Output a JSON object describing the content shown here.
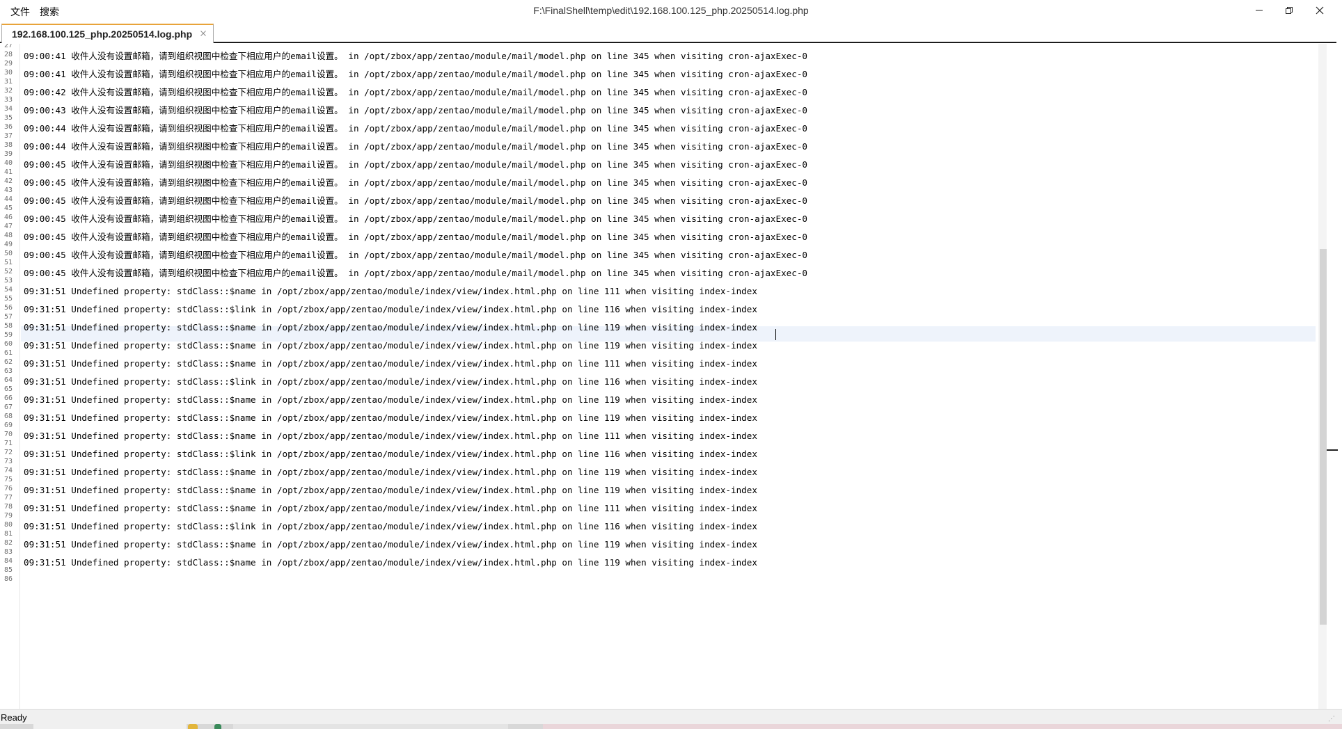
{
  "menu": {
    "file": "文件",
    "search": "搜索"
  },
  "window": {
    "title": "F:\\FinalShell\\temp\\edit\\192.168.100.125_php.20250514.log.php"
  },
  "tab": {
    "label": "192.168.100.125_php.20250514.log.php"
  },
  "status": {
    "text": "Ready"
  },
  "icons": {
    "minimize": "minimize-icon",
    "restore": "restore-icon",
    "close": "close-icon",
    "tab_close": "close-icon"
  },
  "editor": {
    "line_numbers": [
      "27",
      "28",
      "29",
      "30",
      "31",
      "32",
      "33",
      "34",
      "35",
      "36",
      "37",
      "38",
      "39",
      "40",
      "41",
      "42",
      "43",
      "44",
      "45",
      "46",
      "47",
      "48",
      "49",
      "50",
      "51",
      "52",
      "53",
      "54",
      "55",
      "56",
      "57",
      "58",
      "59",
      "60",
      "61",
      "62",
      "63",
      "64",
      "65",
      "66",
      "67",
      "68",
      "69",
      "70",
      "71",
      "72",
      "73",
      "74",
      "75",
      "76",
      "77",
      "78",
      "79",
      "80",
      "81",
      "82",
      "83",
      "84",
      "85",
      "86"
    ],
    "current_line": "53",
    "log_lines": [
      "09:00:41 收件人没有设置邮箱，请到组织视图中检查下相应用户的email设置。 in /opt/zbox/app/zentao/module/mail/model.php on line 345 when visiting cron-ajaxExec-0",
      "09:00:41 收件人没有设置邮箱，请到组织视图中检查下相应用户的email设置。 in /opt/zbox/app/zentao/module/mail/model.php on line 345 when visiting cron-ajaxExec-0",
      "09:00:41 收件人没有设置邮箱，请到组织视图中检查下相应用户的email设置。 in /opt/zbox/app/zentao/module/mail/model.php on line 345 when visiting cron-ajaxExec-0",
      "09:00:42 收件人没有设置邮箱，请到组织视图中检查下相应用户的email设置。 in /opt/zbox/app/zentao/module/mail/model.php on line 345 when visiting cron-ajaxExec-0",
      "09:00:43 收件人没有设置邮箱，请到组织视图中检查下相应用户的email设置。 in /opt/zbox/app/zentao/module/mail/model.php on line 345 when visiting cron-ajaxExec-0",
      "09:00:44 收件人没有设置邮箱，请到组织视图中检查下相应用户的email设置。 in /opt/zbox/app/zentao/module/mail/model.php on line 345 when visiting cron-ajaxExec-0",
      "09:00:44 收件人没有设置邮箱，请到组织视图中检查下相应用户的email设置。 in /opt/zbox/app/zentao/module/mail/model.php on line 345 when visiting cron-ajaxExec-0",
      "09:00:45 收件人没有设置邮箱，请到组织视图中检查下相应用户的email设置。 in /opt/zbox/app/zentao/module/mail/model.php on line 345 when visiting cron-ajaxExec-0",
      "09:00:45 收件人没有设置邮箱，请到组织视图中检查下相应用户的email设置。 in /opt/zbox/app/zentao/module/mail/model.php on line 345 when visiting cron-ajaxExec-0",
      "09:00:45 收件人没有设置邮箱，请到组织视图中检查下相应用户的email设置。 in /opt/zbox/app/zentao/module/mail/model.php on line 345 when visiting cron-ajaxExec-0",
      "09:00:45 收件人没有设置邮箱，请到组织视图中检查下相应用户的email设置。 in /opt/zbox/app/zentao/module/mail/model.php on line 345 when visiting cron-ajaxExec-0",
      "09:00:45 收件人没有设置邮箱，请到组织视图中检查下相应用户的email设置。 in /opt/zbox/app/zentao/module/mail/model.php on line 345 when visiting cron-ajaxExec-0",
      "09:00:45 收件人没有设置邮箱，请到组织视图中检查下相应用户的email设置。 in /opt/zbox/app/zentao/module/mail/model.php on line 345 when visiting cron-ajaxExec-0",
      "09:00:45 收件人没有设置邮箱，请到组织视图中检查下相应用户的email设置。 in /opt/zbox/app/zentao/module/mail/model.php on line 345 when visiting cron-ajaxExec-0",
      "09:31:51 Undefined property: stdClass::$name in /opt/zbox/app/zentao/module/index/view/index.html.php on line 111 when visiting index-index",
      "09:31:51 Undefined property: stdClass::$link in /opt/zbox/app/zentao/module/index/view/index.html.php on line 116 when visiting index-index",
      "09:31:51 Undefined property: stdClass::$name in /opt/zbox/app/zentao/module/index/view/index.html.php on line 119 when visiting index-index",
      "09:31:51 Undefined property: stdClass::$name in /opt/zbox/app/zentao/module/index/view/index.html.php on line 119 when visiting index-index",
      "09:31:51 Undefined property: stdClass::$name in /opt/zbox/app/zentao/module/index/view/index.html.php on line 111 when visiting index-index",
      "09:31:51 Undefined property: stdClass::$link in /opt/zbox/app/zentao/module/index/view/index.html.php on line 116 when visiting index-index",
      "09:31:51 Undefined property: stdClass::$name in /opt/zbox/app/zentao/module/index/view/index.html.php on line 119 when visiting index-index",
      "09:31:51 Undefined property: stdClass::$name in /opt/zbox/app/zentao/module/index/view/index.html.php on line 119 when visiting index-index",
      "09:31:51 Undefined property: stdClass::$name in /opt/zbox/app/zentao/module/index/view/index.html.php on line 111 when visiting index-index",
      "09:31:51 Undefined property: stdClass::$link in /opt/zbox/app/zentao/module/index/view/index.html.php on line 116 when visiting index-index",
      "09:31:51 Undefined property: stdClass::$name in /opt/zbox/app/zentao/module/index/view/index.html.php on line 119 when visiting index-index",
      "09:31:51 Undefined property: stdClass::$name in /opt/zbox/app/zentao/module/index/view/index.html.php on line 119 when visiting index-index",
      "09:31:51 Undefined property: stdClass::$name in /opt/zbox/app/zentao/module/index/view/index.html.php on line 111 when visiting index-index",
      "09:31:51 Undefined property: stdClass::$link in /opt/zbox/app/zentao/module/index/view/index.html.php on line 116 when visiting index-index",
      "09:31:51 Undefined property: stdClass::$name in /opt/zbox/app/zentao/module/index/view/index.html.php on line 119 when visiting index-index",
      "09:31:51 Undefined property: stdClass::$name in /opt/zbox/app/zentao/module/index/view/index.html.php on line 119 when visiting index-index"
    ]
  }
}
